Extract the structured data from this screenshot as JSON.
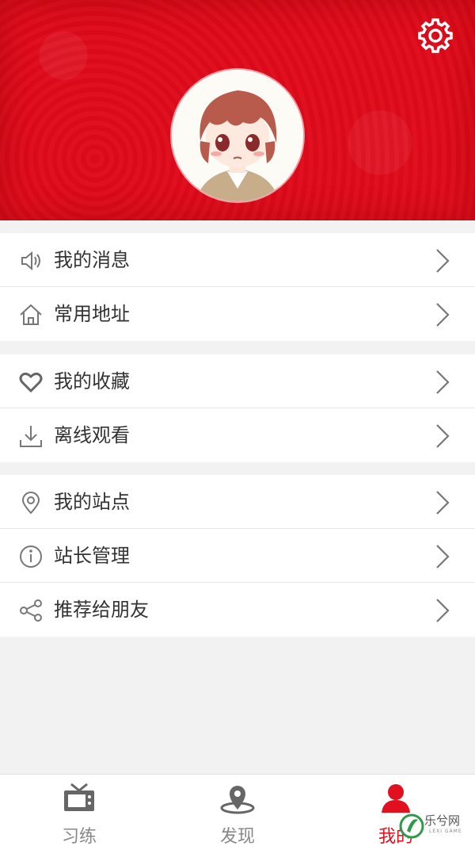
{
  "menu_groups": [
    {
      "items": [
        {
          "icon": "speaker-icon",
          "label": "我的消息"
        },
        {
          "icon": "home-icon",
          "label": "常用地址"
        }
      ]
    },
    {
      "items": [
        {
          "icon": "heart-icon",
          "label": "我的收藏"
        },
        {
          "icon": "download-icon",
          "label": "离线观看"
        }
      ]
    },
    {
      "items": [
        {
          "icon": "location-pin-icon",
          "label": "我的站点"
        },
        {
          "icon": "info-icon",
          "label": "站长管理"
        },
        {
          "icon": "share-icon",
          "label": "推荐给朋友"
        }
      ]
    }
  ],
  "tabbar": {
    "tabs": [
      {
        "icon": "tv-icon",
        "label": "习练"
      },
      {
        "icon": "map-pin-icon",
        "label": "发现"
      },
      {
        "icon": "user-icon",
        "label": "我的",
        "active": true
      }
    ]
  },
  "watermark": {
    "text": "乐兮网",
    "sub": "LEXI GAME"
  },
  "colors": {
    "header": "#dc0c1c",
    "accent": "#e0101f",
    "text": "#333333",
    "icon": "#777777"
  }
}
